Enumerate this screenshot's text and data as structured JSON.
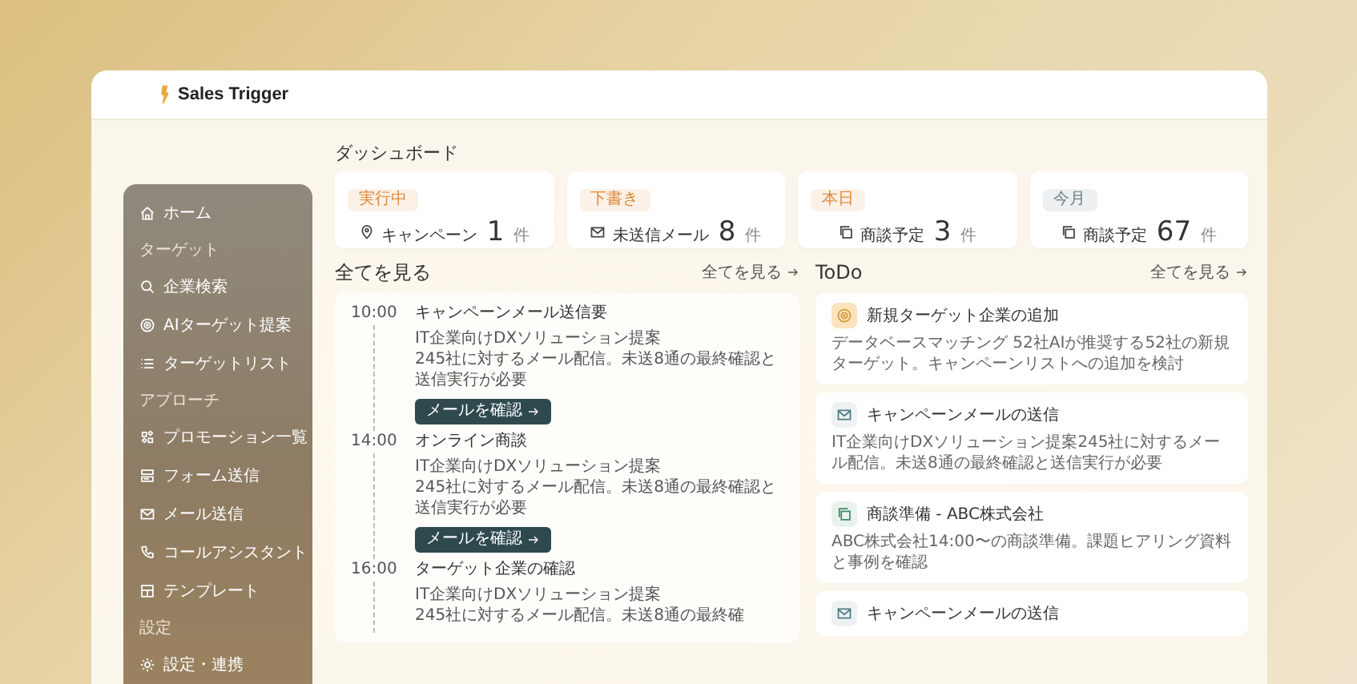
{
  "app": {
    "logo": "Sales Trigger"
  },
  "sidebar": {
    "items": [
      {
        "kind": "home",
        "label": "ホーム"
      },
      {
        "kind": "section",
        "label": "ターゲット"
      },
      {
        "kind": "search",
        "label": "企業検索"
      },
      {
        "kind": "target",
        "label": "AIターゲット提案"
      },
      {
        "kind": "list",
        "label": "ターゲットリスト"
      },
      {
        "kind": "section",
        "label": "アプローチ"
      },
      {
        "kind": "shapes",
        "label": "プロモーション一覧"
      },
      {
        "kind": "form",
        "label": "フォーム送信"
      },
      {
        "kind": "mail",
        "label": "メール送信"
      },
      {
        "kind": "phone",
        "label": "コールアシスタント"
      },
      {
        "kind": "layout",
        "label": "テンプレート"
      },
      {
        "kind": "section",
        "label": "設定"
      },
      {
        "kind": "gear",
        "label": "設定・連携"
      }
    ]
  },
  "page_title": "ダッシュボード",
  "stats": [
    {
      "badge": "実行中",
      "color": "#e0893a",
      "kind": "pin",
      "label": "キャンペーン",
      "value": "1",
      "unit": "件"
    },
    {
      "badge": "下書き",
      "color": "#e0893a",
      "kind": "mail",
      "label": "未送信メール",
      "value": "8",
      "unit": "件"
    },
    {
      "badge": "本日",
      "color": "#e0893a",
      "kind": "copy",
      "label": "商談予定",
      "value": "3",
      "unit": "件"
    },
    {
      "badge": "今月",
      "color": "#6b7f86",
      "kind": "copy",
      "label": "商談予定",
      "value": "67",
      "unit": "件"
    }
  ],
  "schedule": {
    "title": "全てを見る",
    "link": "全てを見る",
    "items": [
      {
        "time": "10:00",
        "title": "キャンペーンメール送信要",
        "subtitle": "IT企業向けDXソリューション提案",
        "desc": "245社に対するメール配信。未送8通の最終確認と送信実行が必要",
        "button": "メールを確認"
      },
      {
        "time": "14:00",
        "title": "オンライン商談",
        "subtitle": "IT企業向けDXソリューション提案",
        "desc": "245社に対するメール配信。未送8通の最終確認と送信実行が必要",
        "button": "メールを確認"
      },
      {
        "time": "16:00",
        "title": "ターゲット企業の確認",
        "subtitle": "IT企業向けDXソリューション提案",
        "desc": "245社に対するメール配信。未送8通の最終確"
      }
    ]
  },
  "todo": {
    "title": "ToDo",
    "link": "全てを見る",
    "items": [
      {
        "kind": "target",
        "title": "新規ターゲット企業の追加",
        "desc": "データベースマッチング 52社AIが推奨する52社の新規ターゲット。キャンペーンリストへの追加を検討"
      },
      {
        "kind": "mail",
        "title": "キャンペーンメールの送信",
        "desc": "IT企業向けDXソリューション提案245社に対するメール配信。未送8通の最終確認と送信実行が必要"
      },
      {
        "kind": "copy",
        "title": "商談準備 - ABC株式会社",
        "desc": "ABC株式会社14:00〜の商談準備。課題ヒアリング資料と事例を確認"
      },
      {
        "kind": "mail",
        "title": "キャンペーンメールの送信"
      }
    ]
  }
}
